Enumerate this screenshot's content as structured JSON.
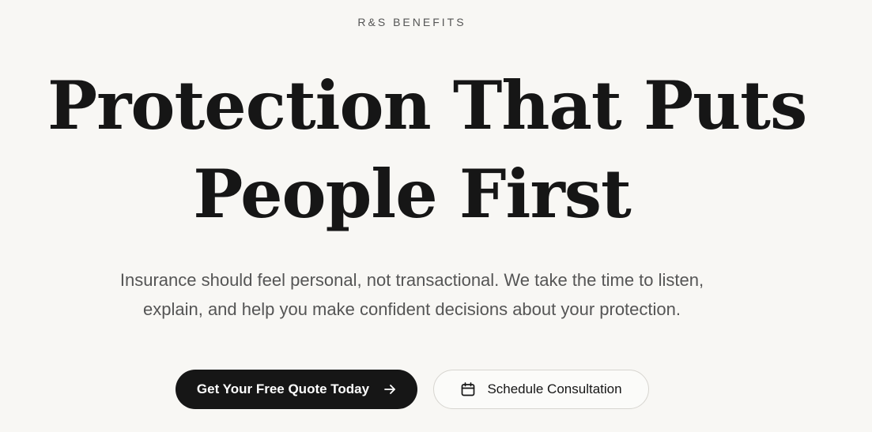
{
  "brand": "R&S BENEFITS",
  "hero": {
    "headline_line1": "Protection That Puts",
    "headline_line2": "People First",
    "subtext_line1": "Insurance should feel personal, not transactional. We take the time to listen,",
    "subtext_line2": "explain, and help you make confident decisions about your protection."
  },
  "cta": {
    "primary_label": "Get Your Free Quote Today",
    "primary_icon": "arrow-right-icon",
    "secondary_label": "Schedule Consultation",
    "secondary_icon": "calendar-icon"
  },
  "colors": {
    "background": "#f8f7f4",
    "text_dark": "#161616",
    "text_muted": "#555555",
    "button_primary": "#161616",
    "button_secondary_border": "#d7d5d0"
  }
}
